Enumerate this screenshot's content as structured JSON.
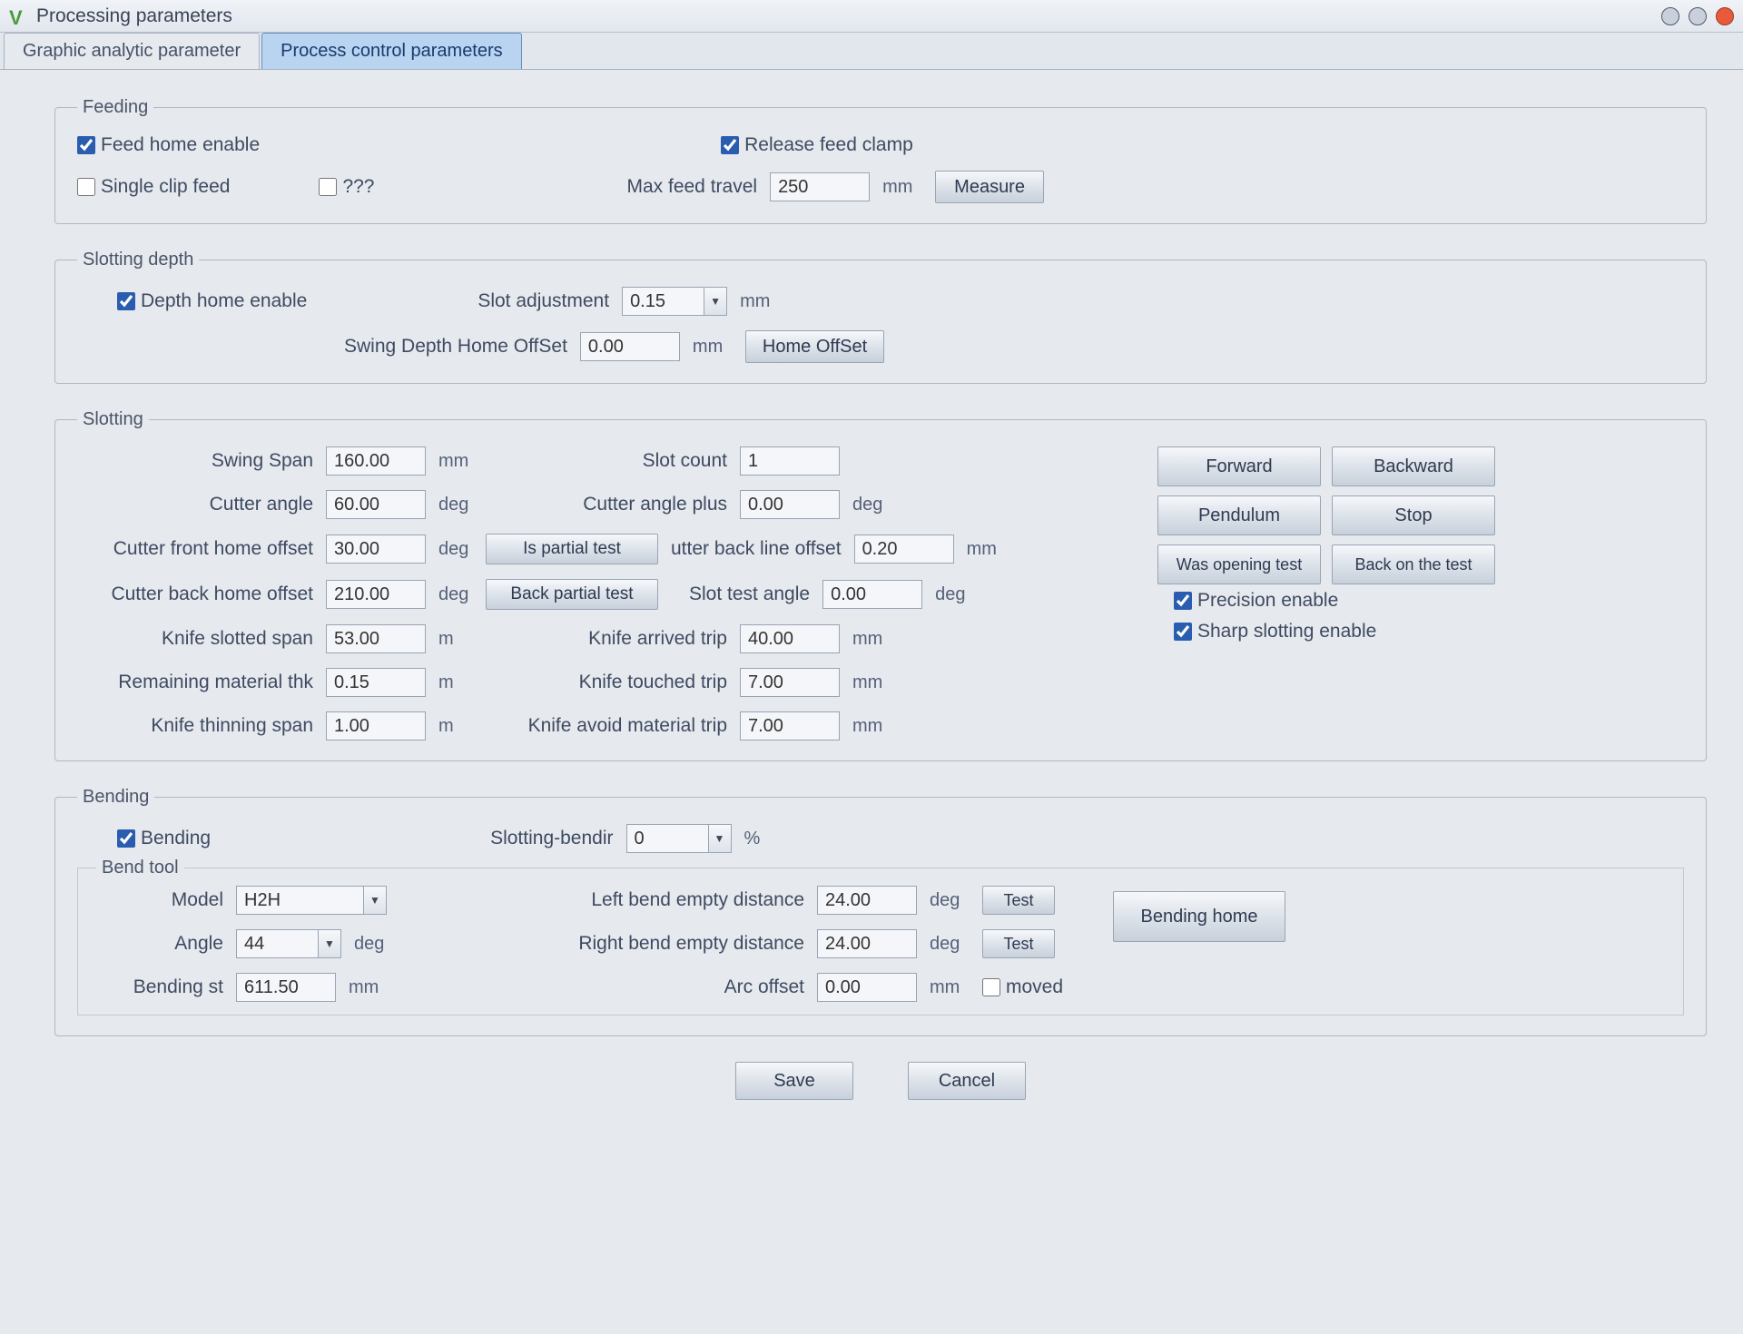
{
  "window": {
    "title": "Processing parameters"
  },
  "tabs": {
    "graphic": "Graphic analytic parameter",
    "process": "Process control parameters"
  },
  "feeding": {
    "legend": "Feeding",
    "feed_home_enable": "Feed home enable",
    "release_feed_clamp": "Release feed clamp",
    "single_clip_feed": "Single clip feed",
    "unknown": "???",
    "max_feed_travel_label": "Max feed travel",
    "max_feed_travel_value": "250",
    "max_feed_travel_unit": "mm",
    "measure_btn": "Measure"
  },
  "slotting_depth": {
    "legend": "Slotting depth",
    "depth_home_enable": "Depth home enable",
    "slot_adjustment_label": "Slot adjustment",
    "slot_adjustment_value": "0.15",
    "slot_adjustment_unit": "mm",
    "swing_depth_home_offset_label": "Swing Depth Home OffSet",
    "swing_depth_home_offset_value": "0.00",
    "swing_depth_home_offset_unit": "mm",
    "home_offset_btn": "Home OffSet"
  },
  "slotting": {
    "legend": "Slotting",
    "swing_span": {
      "label": "Swing Span",
      "value": "160.00",
      "unit": "mm"
    },
    "slot_count": {
      "label": "Slot count",
      "value": "1"
    },
    "cutter_angle": {
      "label": "Cutter angle",
      "value": "60.00",
      "unit": "deg"
    },
    "cutter_angle_plus": {
      "label": "Cutter angle plus",
      "value": "0.00",
      "unit": "deg"
    },
    "cutter_front_home_offset": {
      "label": "Cutter front home offset",
      "value": "30.00",
      "unit": "deg"
    },
    "cutter_back_line_offset": {
      "label": "utter back line offset",
      "value": "0.20",
      "unit": "mm"
    },
    "cutter_back_home_offset": {
      "label": "Cutter back home offset",
      "value": "210.00",
      "unit": "deg"
    },
    "slot_test_angle": {
      "label": "Slot test angle",
      "value": "0.00",
      "unit": "deg"
    },
    "knife_slotted_span": {
      "label": "Knife slotted span",
      "value": "53.00",
      "unit": "m"
    },
    "knife_arrived_trip": {
      "label": "Knife arrived trip",
      "value": "40.00",
      "unit": "mm"
    },
    "remaining_material_thk": {
      "label": "Remaining material thk",
      "value": "0.15",
      "unit": "m"
    },
    "knife_touched_trip": {
      "label": "Knife touched trip",
      "value": "7.00",
      "unit": "mm"
    },
    "knife_thinning_span": {
      "label": "Knife thinning span",
      "value": "1.00",
      "unit": "m"
    },
    "knife_avoid_material_trip": {
      "label": "Knife avoid material trip",
      "value": "7.00",
      "unit": "mm"
    },
    "is_partial_test_btn": "Is partial test",
    "back_partial_test_btn": "Back partial test",
    "forward_btn": "Forward",
    "backward_btn": "Backward",
    "pendulum_btn": "Pendulum",
    "stop_btn": "Stop",
    "was_opening_test_btn": "Was opening test",
    "back_on_the_test_btn": "Back on the test",
    "precision_enable": "Precision enable",
    "sharp_slotting_enable": "Sharp slotting enable"
  },
  "bending": {
    "legend": "Bending",
    "bending_chk": "Bending",
    "slotting_bendir_label": "Slotting-bendir",
    "slotting_bendir_value": "0",
    "slotting_bendir_unit": "%",
    "bend_tool_legend": "Bend tool",
    "model_label": "Model",
    "model_value": "H2H",
    "angle_label": "Angle",
    "angle_value": "44",
    "angle_unit": "deg",
    "bending_st_label": "Bending st",
    "bending_st_value": "611.50",
    "bending_st_unit": "mm",
    "left_bend_empty_label": "Left bend empty distance",
    "left_bend_empty_value": "24.00",
    "left_bend_empty_unit": "deg",
    "right_bend_empty_label": "Right bend empty distance",
    "right_bend_empty_value": "24.00",
    "right_bend_empty_unit": "deg",
    "arc_offset_label": "Arc offset",
    "arc_offset_value": "0.00",
    "arc_offset_unit": "mm",
    "test_btn": "Test",
    "bending_home_btn": "Bending home",
    "moved_chk": "moved"
  },
  "actions": {
    "save": "Save",
    "cancel": "Cancel"
  }
}
